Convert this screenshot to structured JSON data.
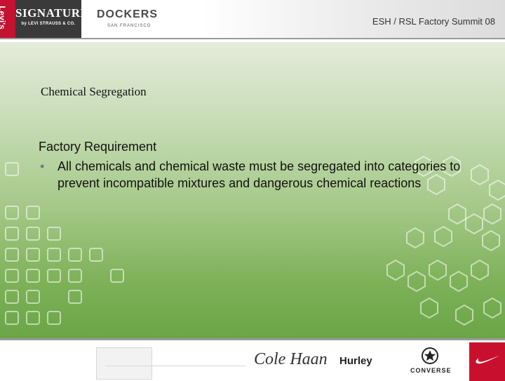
{
  "header": {
    "levis_logo_text": "Levi's",
    "signature_logo": {
      "word": "SIGNATURE",
      "sub": "by LEVI STRAUSS & CO."
    },
    "dockers_logo": {
      "word": "DOCKERS",
      "sub": "SAN FRANCISCO"
    },
    "title": "ESH / RSL Factory Summit 08"
  },
  "slide": {
    "heading": "Chemical Segregation",
    "subhead": "Factory Requirement",
    "bullet_marker": "•",
    "bullets": [
      "All chemicals and chemical waste must be segregated into categories to prevent incompatible mixtures and dangerous chemical reactions"
    ]
  },
  "footer": {
    "brands": [
      "Cole Haan",
      "Hurley",
      "CONVERSE",
      "Nike"
    ],
    "cole_haan_text": "Cole Haan",
    "hurley_text": "Hurley",
    "converse_text": "CONVERSE"
  },
  "colors": {
    "levis_red": "#c41230",
    "signature_bg": "#3a3a3a",
    "panel_top": "#e4ecdb",
    "panel_bottom": "#6aa546",
    "nike_red": "#c8102e"
  }
}
